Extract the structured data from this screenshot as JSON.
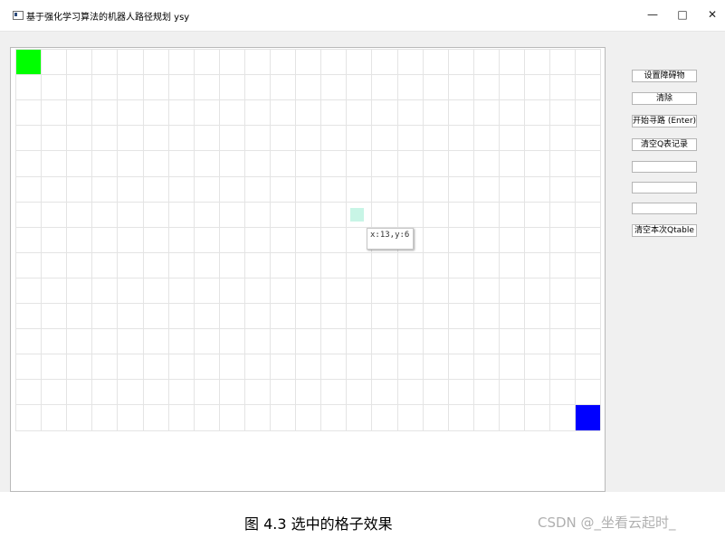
{
  "window": {
    "title": "基于强化学习算法的机器人路径规划 ysy",
    "minimize_icon": "minimize-icon",
    "maximize_icon": "maximize-icon",
    "close_icon": "close-icon"
  },
  "grid": {
    "cols": 23,
    "rows": 15,
    "start_color": "#00ff00",
    "goal_color": "#0000ff",
    "selected_color": "#c8f5e6",
    "start_cell": {
      "col": 0,
      "row": 0
    },
    "goal_cell": {
      "col": 22,
      "row": 14
    },
    "selected_cell": {
      "col": 13,
      "row": 6
    },
    "tooltip": "x:13,y:6"
  },
  "sidebar": {
    "set_obstacles": "设置障碍物",
    "clear": "清除",
    "start_path": "开始寻路 (Enter)",
    "clear_q_records": "清空Q表记录",
    "input_1": "",
    "input_2": "",
    "input_3": "",
    "clear_current_qtable": "清空本次Qtable"
  },
  "caption": "图 4.3 选中的格子效果",
  "watermark": "CSDN @_坐看云起时_"
}
